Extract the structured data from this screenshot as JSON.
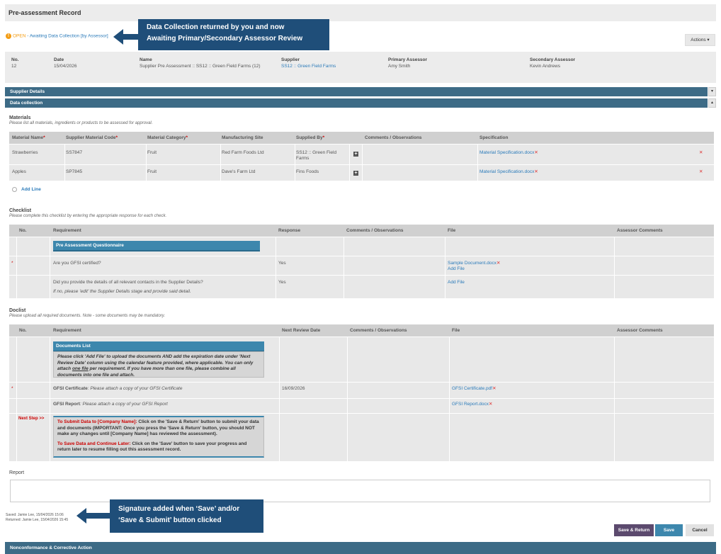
{
  "page_title": "Pre-assessment Record",
  "status": {
    "open": "OPEN",
    "text": " - Awaiting Data Collection [by Assessor]"
  },
  "actions_label": "Actions ▾",
  "callout_top": {
    "line1": "Data Collection returned by you and now",
    "line2": "Awaiting Primary/Secondary Assessor Review"
  },
  "callout_bottom": {
    "line1": "Signature added when ‘Save’ and/or",
    "line2": "‘Save & Submit’ button clicked"
  },
  "info": {
    "no_label": "No.",
    "no_value": "12",
    "date_label": "Date",
    "date_value": "15/04/2026",
    "name_label": "Name",
    "name_value": "Supplier Pre Assessment :: SS12 :: Green Field Farms (12)",
    "supplier_label": "Supplier",
    "supplier_value": "SS12 :: Green Field Farms",
    "primary_label": "Primary Assessor",
    "primary_value": "Amy Smith",
    "secondary_label": "Secondary Assessor",
    "secondary_value": "Kevin Andrews"
  },
  "sections": {
    "supplier_details": "Supplier Details",
    "data_collection": "Data collection"
  },
  "materials": {
    "title": "Materials",
    "subtitle": "Please list all materials, ingredients or products to be assessed for approval.",
    "headers": [
      "Material Name",
      "Supplier Material Code",
      "Material Category",
      "Manufacturing Site",
      "Supplied By",
      "Comments / Observations",
      "Specification"
    ],
    "rows": [
      {
        "name": "Strawberries",
        "code": "SS7847",
        "category": "Fruit",
        "site": "Red Farm Foods Ltd",
        "supplied_l1": "SS12 :: Green Field",
        "supplied_l2": "Farms",
        "spec": "Material Specification.docx"
      },
      {
        "name": "Apples",
        "code": "SP7845",
        "category": "Fruit",
        "site": "Dave's Farm Ltd",
        "supplied_l1": "Fins Foods",
        "supplied_l2": "",
        "spec": "Material Specification.docx"
      }
    ],
    "add_line": "Add Line"
  },
  "checklist": {
    "title": "Checklist",
    "subtitle": "Please complete this checklist by entering the appropriate response for each check.",
    "headers": [
      "No.",
      "Requirement",
      "Response",
      "Comments / Observations",
      "File",
      "Assessor Comments"
    ],
    "subhdr": "Pre Assessment Questionnaire",
    "rows": [
      {
        "req": "Are you GFSI certified?",
        "resp": "Yes",
        "file": "Sample Document.docx",
        "add": "Add File"
      },
      {
        "req": "Did you provide the details of all relevant contacts in the Supplier Details?",
        "req2": "If no, please 'edit' the Supplier Details stage and provide said detail.",
        "resp": "Yes",
        "add": "Add File"
      }
    ]
  },
  "doclist": {
    "title": "Doclist",
    "subtitle": "Please upload all required documents. Note - some documents may be mandatory.",
    "headers": [
      "No.",
      "Requirement",
      "Next Review Date",
      "Comments / Observations",
      "File",
      "Assessor Comments"
    ],
    "subhdr": "Documents List",
    "instructions_a": "Please click 'Add File' to upload the documents AND add the expiration date under 'Next Review Date' column using the calendar feature provided, where applicable. You can only attach ",
    "instructions_u": "one file",
    "instructions_b": " per requirement. If you have more than one file, please combine all documents into one file and attach.",
    "rows": [
      {
        "req_bold": "GFSI Certificate",
        "req_rest": ": Please attach a copy of your GFSI Certificate",
        "date": "16/09/2026",
        "file": "GFSI Certificate.pdf"
      },
      {
        "req_bold": "GFSI Report",
        "req_rest": ": Please attach a copy of your GFSI Report",
        "date": "",
        "file": "GFSI Report.docx"
      }
    ],
    "next_step": "Next Step >>",
    "submit_title": "To Submit Data to [Company Name]:",
    "submit_text": " Click on the 'Save & Return' button to submit your data and documents (IMPORTANT: Once you press the 'Save & Return' button, you should NOT make any changes until [Company Name] has reviewed the assessment).",
    "later_title": "To Save Data and Continue Later:",
    "later_text": " Click on the 'Save' button to save your progress and return later to resume filling out this assessment record."
  },
  "report_label": "Report",
  "saved_line": "Saved: Jamie Lee, 15/04/2026 15:06",
  "returned_line": "Returned: Jamie Lee, 15/04/2026 15:45",
  "buttons": {
    "save_return": "Save & Return",
    "save": "Save",
    "cancel": "Cancel"
  },
  "bottom_section": "Nonconformance & Corrective Action"
}
